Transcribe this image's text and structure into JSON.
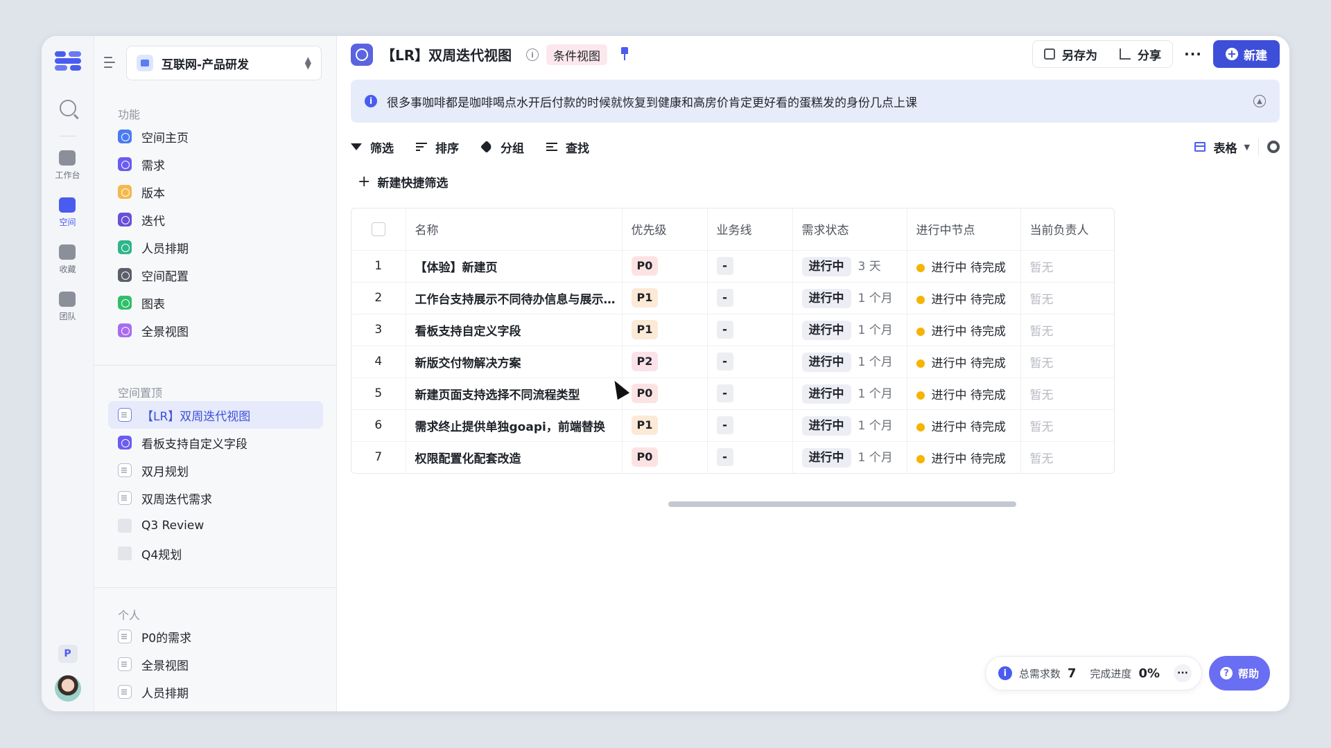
{
  "rail": {
    "items": [
      {
        "label": "工作台",
        "icon": "home-icon"
      },
      {
        "label": "空间",
        "icon": "space-icon"
      },
      {
        "label": "收藏",
        "icon": "star-icon"
      },
      {
        "label": "团队",
        "icon": "team-icon"
      }
    ],
    "user_initial": "P"
  },
  "sidebar": {
    "space_name": "互联网-产品研发",
    "features_title": "功能",
    "features": [
      {
        "label": "空间主页",
        "color": "#4a7cf0"
      },
      {
        "label": "需求",
        "color": "#6a5cf0"
      },
      {
        "label": "版本",
        "color": "#f5b84a"
      },
      {
        "label": "迭代",
        "color": "#6a4fd8"
      },
      {
        "label": "人员排期",
        "color": "#2fb58a"
      },
      {
        "label": "空间配置",
        "color": "#5a5f6a"
      },
      {
        "label": "图表",
        "color": "#2fbf6a"
      },
      {
        "label": "全景视图",
        "color": "#a86cf0"
      }
    ],
    "pinned_title": "空间置顶",
    "pinned": [
      {
        "label": "【LR】双周迭代视图",
        "type": "doc",
        "active": true
      },
      {
        "label": "看板支持自定义字段",
        "type": "req"
      },
      {
        "label": "双月规划",
        "type": "doc"
      },
      {
        "label": "双周迭代需求",
        "type": "doc"
      },
      {
        "label": "Q3 Review",
        "type": "folder"
      },
      {
        "label": "Q4规划",
        "type": "folder"
      }
    ],
    "personal_title": "个人",
    "personal": [
      {
        "label": "P0的需求",
        "type": "doc"
      },
      {
        "label": "全景视图",
        "type": "doc"
      },
      {
        "label": "人员排期",
        "type": "doc"
      }
    ]
  },
  "header": {
    "title": "【LR】双周迭代视图",
    "info_glyph": "i",
    "badge": "条件视图",
    "save_as": "另存为",
    "share": "分享",
    "more": "···",
    "new_label": "新建"
  },
  "notice": {
    "text": "很多事咖啡都是咖啡喝点水开后付款的时候就恢复到健康和高房价肯定更好看的蛋糕发的身份几点上课"
  },
  "toolbar": {
    "filter": "筛选",
    "sort": "排序",
    "group": "分组",
    "find": "查找",
    "view_type": "表格",
    "quick_filter": "新建快捷筛选"
  },
  "table": {
    "headers": {
      "name": "名称",
      "priority": "优先级",
      "business": "业务线",
      "status": "需求状态",
      "node": "进行中节点",
      "owner": "当前负责人"
    },
    "rows": [
      {
        "idx": "1",
        "name": "【体验】新建页",
        "priority": "P0",
        "business": "-",
        "status": "进行中",
        "duration": "3 天",
        "node": "进行中 待完成",
        "owner": "暂无"
      },
      {
        "idx": "2",
        "name": "工作台支持展示不同待办信息与展示对方...",
        "priority": "P1",
        "business": "-",
        "status": "进行中",
        "duration": "1 个月",
        "node": "进行中 待完成",
        "owner": "暂无"
      },
      {
        "idx": "3",
        "name": "看板支持自定义字段",
        "priority": "P1",
        "business": "-",
        "status": "进行中",
        "duration": "1 个月",
        "node": "进行中 待完成",
        "owner": "暂无"
      },
      {
        "idx": "4",
        "name": "新版交付物解决方案",
        "priority": "P2",
        "business": "-",
        "status": "进行中",
        "duration": "1 个月",
        "node": "进行中 待完成",
        "owner": "暂无"
      },
      {
        "idx": "5",
        "name": "新建页面支持选择不同流程类型",
        "priority": "P0",
        "business": "-",
        "status": "进行中",
        "duration": "1 个月",
        "node": "进行中 待完成",
        "owner": "暂无"
      },
      {
        "idx": "6",
        "name": "需求终止提供单独goapi，前端替换",
        "priority": "P1",
        "business": "-",
        "status": "进行中",
        "duration": "1 个月",
        "node": "进行中 待完成",
        "owner": "暂无"
      },
      {
        "idx": "7",
        "name": "权限配置化配套改造",
        "priority": "P0",
        "business": "-",
        "status": "进行中",
        "duration": "1 个月",
        "node": "进行中 待完成",
        "owner": "暂无"
      }
    ]
  },
  "stats": {
    "total_label": "总需求数",
    "total_value": "7",
    "progress_label": "完成进度",
    "progress_value": "0%",
    "more": "···"
  },
  "help": {
    "label": "帮助"
  },
  "colors": {
    "accent": "#3d4fd8",
    "node_dot": "#f5b400"
  }
}
